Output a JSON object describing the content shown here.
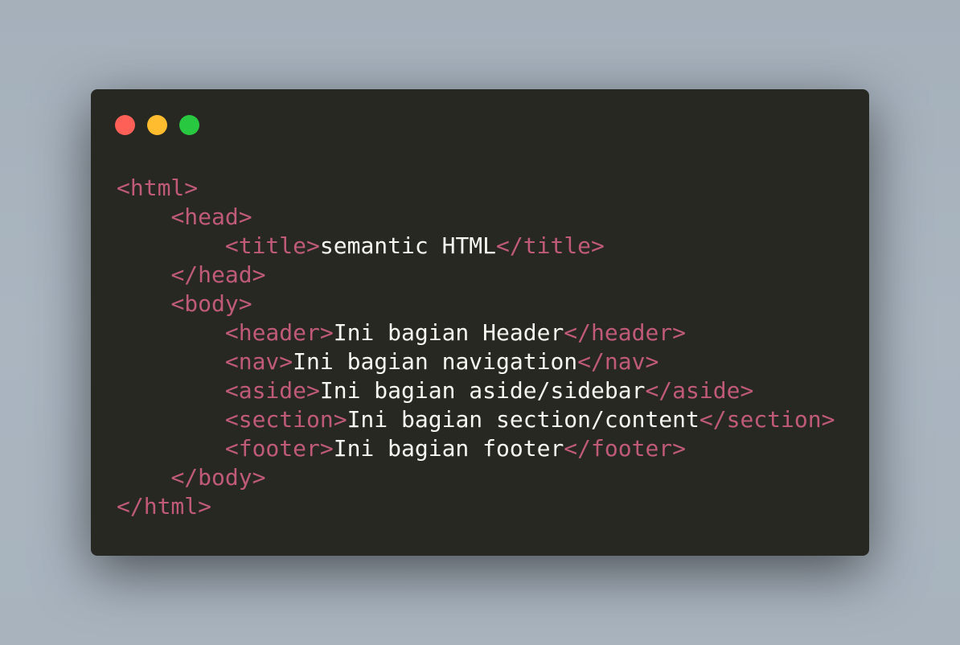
{
  "window": {
    "controls": [
      {
        "name": "close-button",
        "color": "#fe5f57"
      },
      {
        "name": "minimize-button",
        "color": "#febc2e"
      },
      {
        "name": "zoom-button",
        "color": "#28c840"
      }
    ]
  },
  "colors": {
    "background": "#a9b4bf",
    "editor_bg": "#282823",
    "tag": "#c05a79",
    "text": "#f7f7f2"
  },
  "code": {
    "lines": [
      {
        "indent": "",
        "open": "<html>",
        "content": "",
        "close": ""
      },
      {
        "indent": "    ",
        "open": "<head>",
        "content": "",
        "close": ""
      },
      {
        "indent": "        ",
        "open": "<title>",
        "content": "semantic HTML",
        "close": "</title>"
      },
      {
        "indent": "    ",
        "open": "</head>",
        "content": "",
        "close": ""
      },
      {
        "indent": "    ",
        "open": "<body>",
        "content": "",
        "close": ""
      },
      {
        "indent": "        ",
        "open": "<header>",
        "content": "Ini bagian Header",
        "close": "</header>"
      },
      {
        "indent": "        ",
        "open": "<nav>",
        "content": "Ini bagian navigation",
        "close": "</nav>"
      },
      {
        "indent": "        ",
        "open": "<aside>",
        "content": "Ini bagian aside/sidebar",
        "close": "</aside>"
      },
      {
        "indent": "        ",
        "open": "<section>",
        "content": "Ini bagian section/content",
        "close": "</section>"
      },
      {
        "indent": "        ",
        "open": "<footer>",
        "content": "Ini bagian footer",
        "close": "</footer>"
      },
      {
        "indent": "    ",
        "open": "</body>",
        "content": "",
        "close": ""
      },
      {
        "indent": "",
        "open": "</html>",
        "content": "",
        "close": ""
      }
    ]
  }
}
